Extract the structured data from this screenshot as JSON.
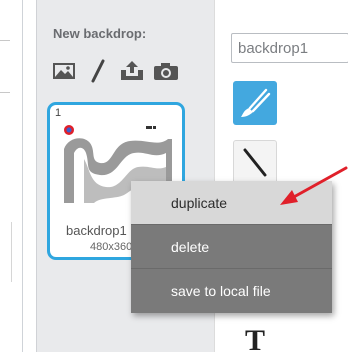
{
  "backdrop_panel": {
    "new_backdrop_label": "New backdrop:",
    "tools": [
      {
        "icon": "landscape-image-icon"
      },
      {
        "icon": "paintbrush-pencil-icon"
      },
      {
        "icon": "upload-icon"
      },
      {
        "icon": "camera-icon"
      }
    ],
    "thumbnail": {
      "index": "1",
      "name": "backdrop1",
      "size": "480x360",
      "selected": true
    }
  },
  "editor": {
    "name_field_value": "backdrop1",
    "tools": [
      {
        "icon": "brush-icon",
        "active": true
      },
      {
        "icon": "line-icon",
        "active": false
      },
      {
        "icon": "text-icon",
        "label": "T"
      }
    ]
  },
  "context_menu": {
    "items": [
      {
        "label": "duplicate",
        "highlighted": true
      },
      {
        "label": "delete",
        "highlighted": false
      },
      {
        "label": "save to local file",
        "highlighted": false
      }
    ]
  },
  "colors": {
    "selection_blue": "#2fa6df",
    "menu_gray": "#7a7a7a",
    "arrow_red": "#e0202a"
  }
}
